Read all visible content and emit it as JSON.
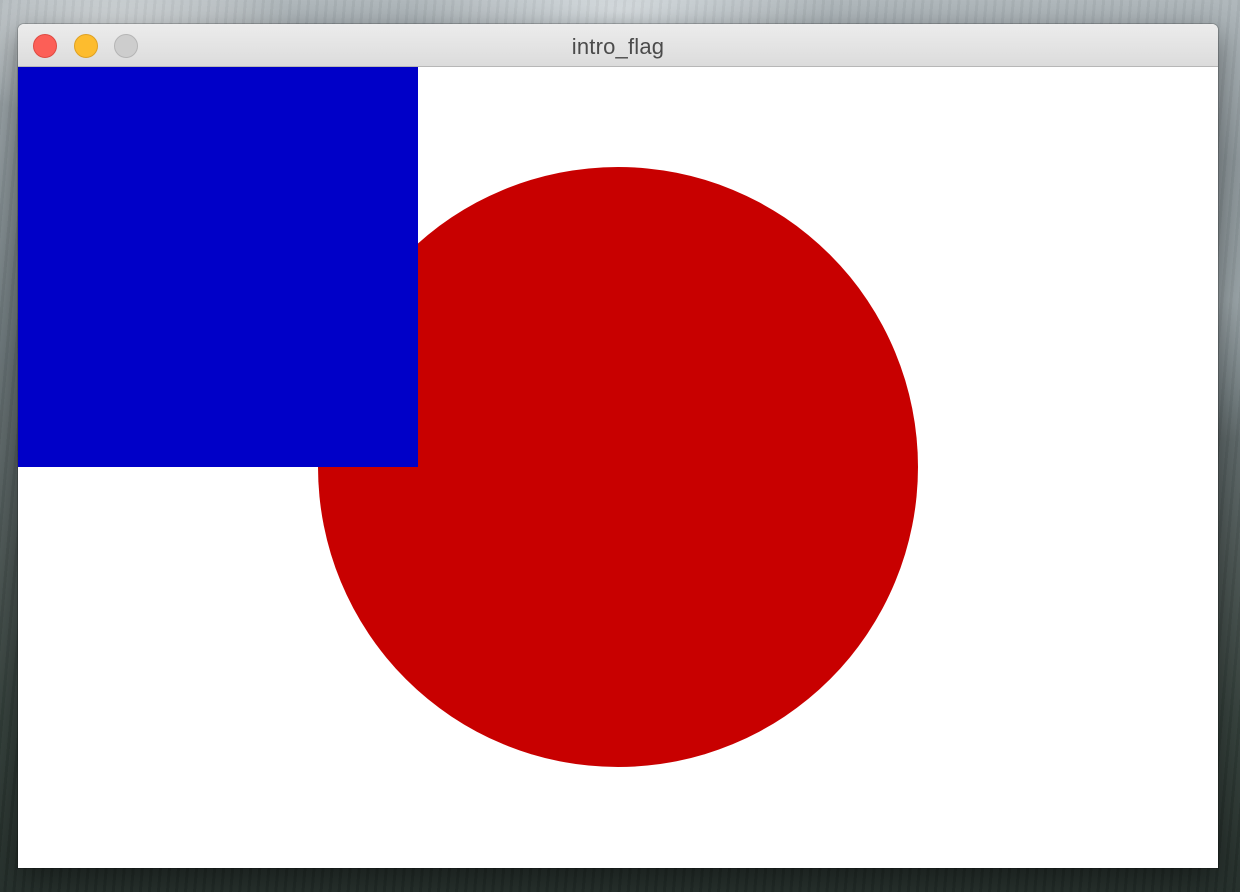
{
  "window": {
    "title": "intro_flag"
  },
  "controls": {
    "close": "close-button",
    "minimize": "minimize-button",
    "zoom": "zoom-button"
  },
  "colors": {
    "close": "#fc5f57",
    "minimize": "#fdbc2e",
    "zoom_inactive": "#cdcdcd",
    "canvas_background": "#ffffff",
    "circle": "#c80000",
    "square": "#0000c8"
  }
}
